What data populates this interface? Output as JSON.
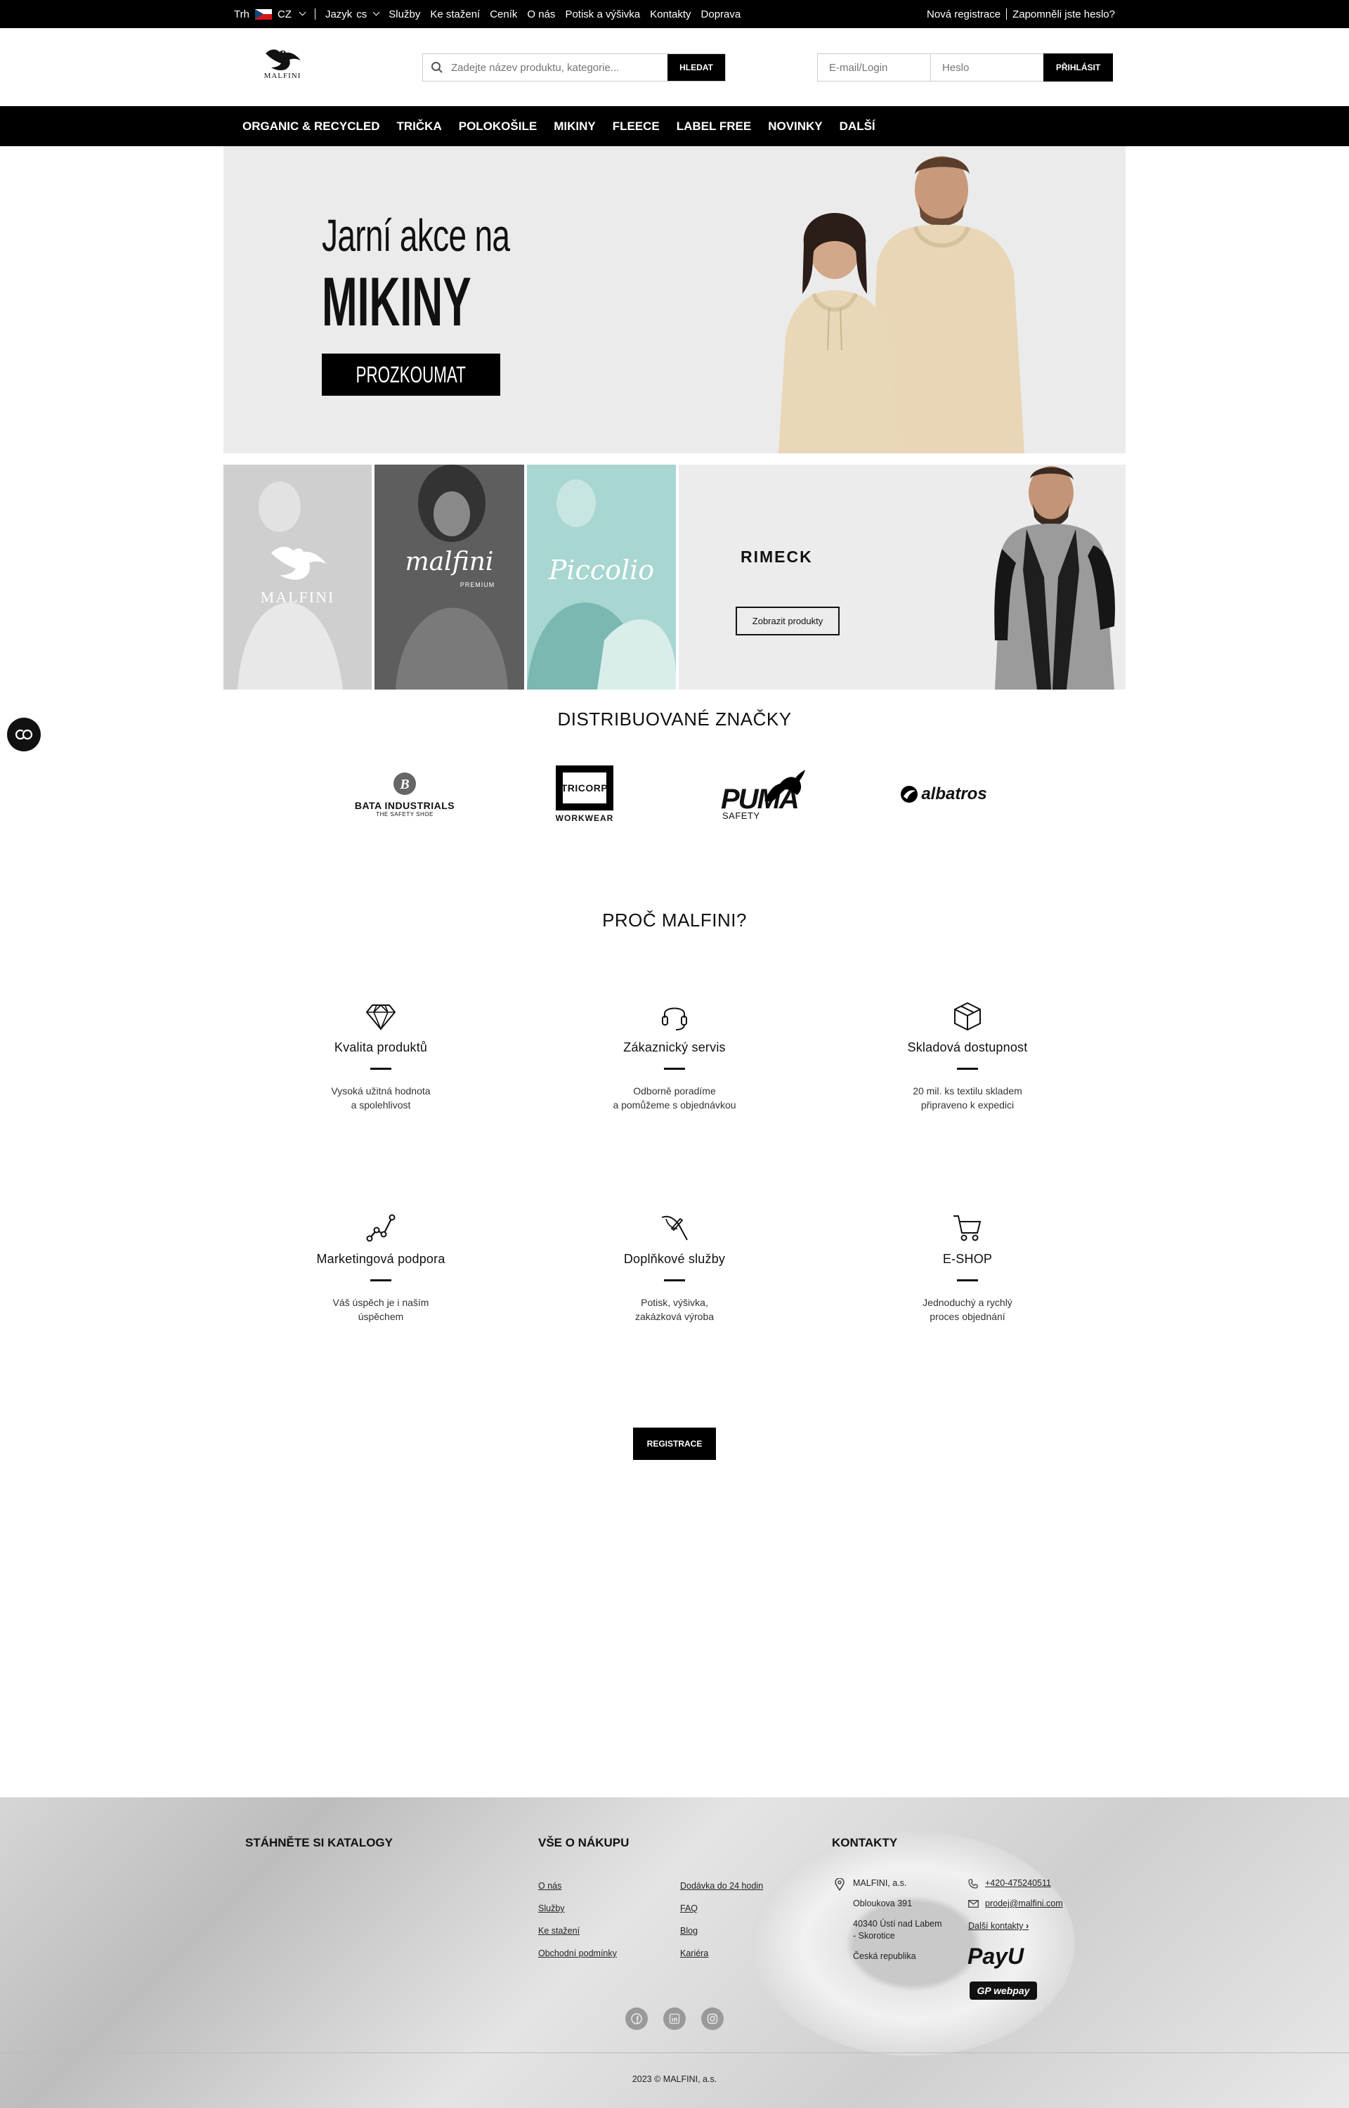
{
  "topbar": {
    "market_label": "Trh",
    "market_value": "CZ",
    "language_label": "Jazyk",
    "language_value": "cs",
    "links": [
      "Služby",
      "Ke stažení",
      "Ceník",
      "O nás",
      "Potisk a výšivka",
      "Kontakty",
      "Doprava"
    ],
    "register": "Nová registrace",
    "forgot": "Zapomněli jste heslo?"
  },
  "header": {
    "logo_text": "MALFINI",
    "search_placeholder": "Zadejte název produktu, kategorie...",
    "search_button": "HLEDAT",
    "email_placeholder": "E-mail/Login",
    "password_placeholder": "Heslo",
    "login_button": "PŘIHLÁSIT"
  },
  "nav": [
    "ORGANIC & RECYCLED",
    "TRIČKA",
    "POLOKOŠILE",
    "MIKINY",
    "FLEECE",
    "LABEL FREE",
    "NOVINKY",
    "DALŠÍ"
  ],
  "hero": {
    "line1": "Jarní akce na",
    "line2": "MIKINY",
    "button": "PROZKOUMAT"
  },
  "tiles": {
    "malfini": "MALFINI",
    "malfini_premium_script": "malfini",
    "malfini_premium_sub": "PREMIUM",
    "piccolio": "Piccolio",
    "rimeck": "RIMECK",
    "rimeck_button": "Zobrazit produkty"
  },
  "badge": "CO",
  "brands": {
    "title": "DISTRIBUOVANÉ ZNAČKY",
    "bata_main": "BATA INDUSTRIALS",
    "bata_sub": "THE SAFETY SHOE",
    "tricorp_main": "TRICORP",
    "tricorp_sub": "WORKWEAR",
    "puma_main": "PUMA",
    "puma_sub": "SAFETY",
    "albatros": "albatros"
  },
  "why": {
    "title": "PROČ MALFINI?",
    "features": [
      {
        "icon": "diamond-icon",
        "title": "Kvalita produktů",
        "line1": "Vysoká užitná hodnota",
        "line2": "a spolehlivost"
      },
      {
        "icon": "headset-icon",
        "title": "Zákaznický servis",
        "line1": "Odborně poradíme",
        "line2": "a pomůžeme s objednávkou"
      },
      {
        "icon": "box-icon",
        "title": "Skladová dostupnost",
        "line1": "20 mil. ks textilu skladem",
        "line2": "připraveno k expedici"
      },
      {
        "icon": "chart-icon",
        "title": "Marketingová podpora",
        "line1": "Váš úspěch je i naším",
        "line2": "úspěchem"
      },
      {
        "icon": "needle-icon",
        "title": "Doplňkové služby",
        "line1": "Potisk, výšivka,",
        "line2": "zakázková výroba"
      },
      {
        "icon": "cart-icon",
        "title": "E-SHOP",
        "line1": "Jednoduchý a rychlý",
        "line2": "proces objednání"
      }
    ],
    "register_button": "REGISTRACE"
  },
  "footer": {
    "catalogs_title": "STÁHNĚTE SI KATALOGY",
    "purchase_title": "VŠE O NÁKUPU",
    "purchase_links_col1": [
      "O nás",
      "Služby",
      "Ke stažení",
      "Obchodní podmínky"
    ],
    "purchase_links_col2": [
      "Dodávka do 24 hodin",
      "FAQ",
      "Blog",
      "Kariéra"
    ],
    "contacts_title": "KONTAKTY",
    "company": "MALFINI, a.s.",
    "street": "Obloukova 391",
    "city_line1": "40340 Ústí nad Labem",
    "city_line2": "- Skorotice",
    "country": "Česká republika",
    "phone": "+420-475240511",
    "email": "prodej@malfini.com",
    "more_contacts": "Další kontakty",
    "payu": "PayU",
    "gp": "GP webpay",
    "copyright": "2023 © MALFINI, a.s."
  }
}
